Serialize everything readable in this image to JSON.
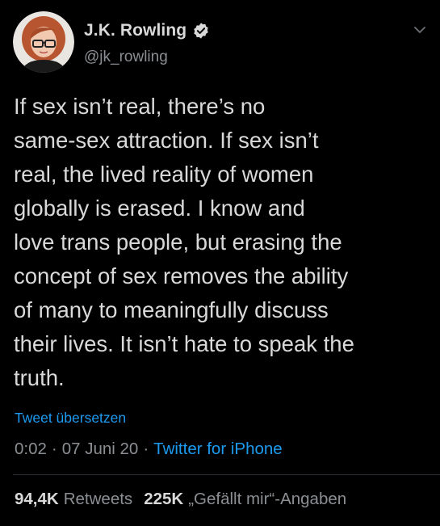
{
  "author": {
    "name": "J.K. Rowling",
    "handle": "@jk_rowling",
    "verified": true,
    "avatar_icon": "profile-photo"
  },
  "tweet": {
    "text": "If sex isn’t real, there’s no\nsame-sex attraction. If sex isn’t\nreal, the lived reality of women\nglobally is erased. I know and\nlove trans people, but erasing the\nconcept of sex removes the ability\nof many to meaningfully discuss\ntheir lives. It isn’t hate to speak the\ntruth.",
    "translate_label": "Tweet übersetzen"
  },
  "meta": {
    "time": "0:02",
    "separator": "·",
    "date": "07 Juni 20",
    "source": "Twitter for iPhone"
  },
  "stats": {
    "retweets_count": "94,4K",
    "retweets_label": "Retweets",
    "likes_count": "225K",
    "likes_label": "„Gefällt mir“-Angaben"
  },
  "colors": {
    "background": "#000000",
    "text": "#d9d9d9",
    "secondary": "#8b8f93",
    "link": "#1d9bf0",
    "verified_badge": "#d9d9d9"
  },
  "icons": {
    "menu": "chevron-down-icon",
    "verified": "verified-icon"
  }
}
